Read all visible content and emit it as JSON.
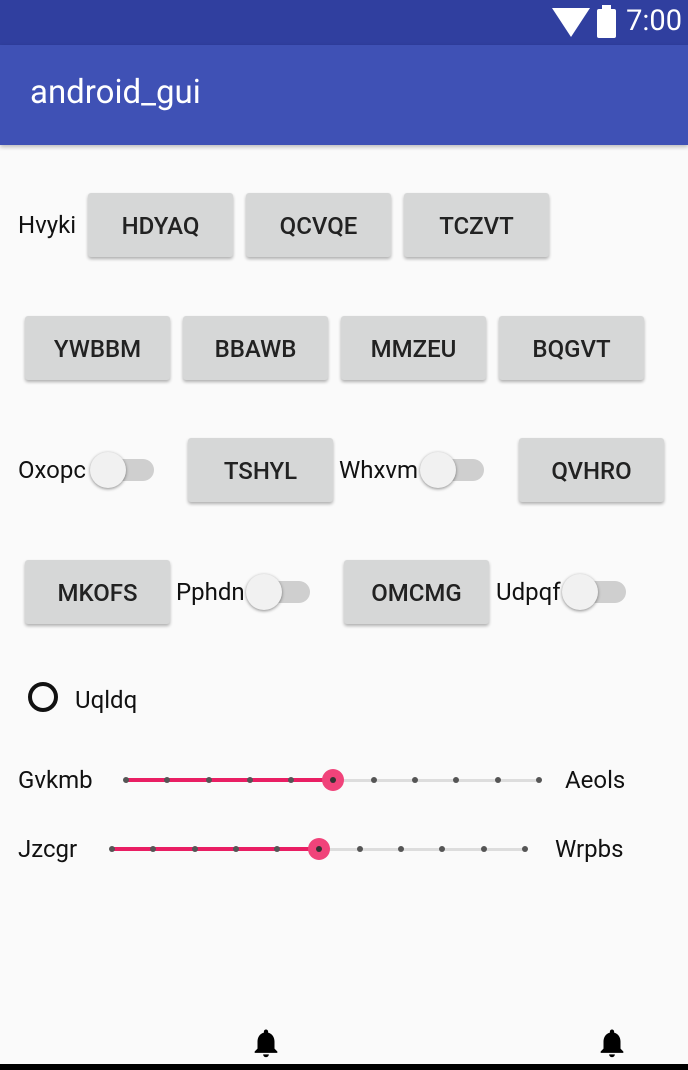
{
  "status_bar": {
    "time": "7:00",
    "icons": [
      "wifi-icon",
      "battery-icon"
    ]
  },
  "app_bar": {
    "title": "android_gui"
  },
  "row1": {
    "label": "Hvyki",
    "buttons": [
      "HDYAQ",
      "QCVQE",
      "TCZVT"
    ]
  },
  "row2": {
    "buttons": [
      "YWBBM",
      "BBAWB",
      "MMZEU",
      "BQGVT"
    ]
  },
  "row3": {
    "switch1_label": "Oxopc",
    "switch1_on": false,
    "button1": "TSHYL",
    "switch2_label": "Whxvm",
    "switch2_on": false,
    "button2": "QVHRO"
  },
  "row4": {
    "button1": "MKOFS",
    "switch1_label": "Pphdn",
    "switch1_on": false,
    "button2": "OMCMG",
    "switch2_label": "Udpqf",
    "switch2_on": false
  },
  "radio": {
    "label": "Uqldq",
    "checked": false
  },
  "seekbars": [
    {
      "left_label": "Gvkmb",
      "right_label": "Aeols",
      "value": 5,
      "max": 10
    },
    {
      "left_label": "Jzcgr",
      "right_label": "Wrpbs",
      "value": 5,
      "max": 10
    }
  ],
  "bottom_icons": [
    "bell-icon",
    "bell-icon"
  ],
  "colors": {
    "status_bar": "#303f9f",
    "app_bar": "#3f51b5",
    "accent": "#e91e63",
    "button": "#d6d7d7"
  }
}
